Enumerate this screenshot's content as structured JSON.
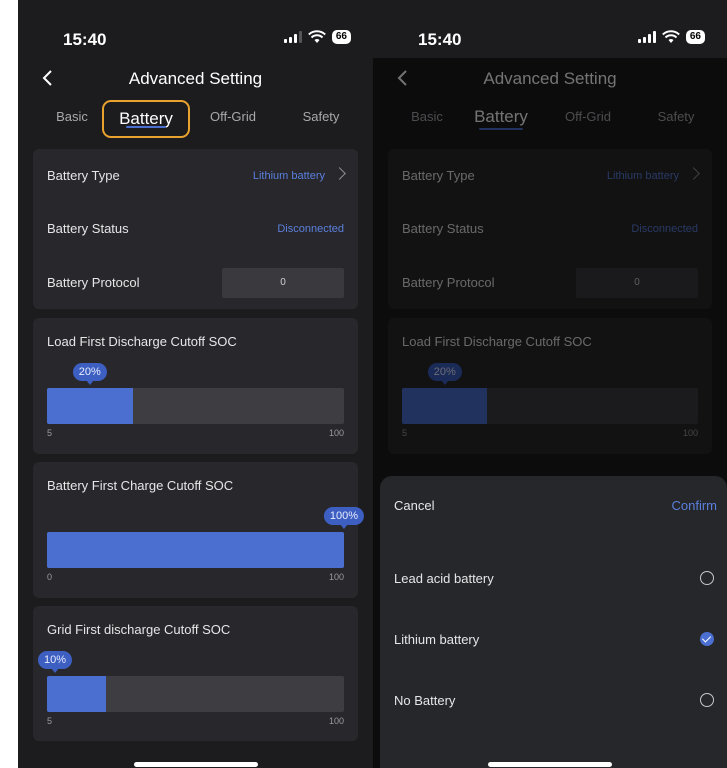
{
  "status": {
    "time": "15:40",
    "battery": "66"
  },
  "header": {
    "title": "Advanced Setting"
  },
  "tabs": [
    {
      "label": "Basic"
    },
    {
      "label": "Battery"
    },
    {
      "label": "Off-Grid"
    },
    {
      "label": "Safety"
    }
  ],
  "battery_info": {
    "type_label": "Battery Type",
    "type_value": "Lithium battery",
    "status_label": "Battery Status",
    "status_value": "Disconnected",
    "protocol_label": "Battery Protocol",
    "protocol_value": "0"
  },
  "sliders": {
    "load_first": {
      "title": "Load First Discharge Cutoff SOC",
      "value_text": "20%",
      "value": 20,
      "min": 5,
      "max": 100,
      "min_label": "5",
      "max_label": "100"
    },
    "battery_first": {
      "title": "Battery First Charge Cutoff SOC",
      "value_text": "100%",
      "value": 100,
      "min": 0,
      "max": 100,
      "min_label": "0",
      "max_label": "100"
    },
    "grid_first": {
      "title": "Grid First discharge Cutoff SOC",
      "value_text": "10%",
      "value": 10,
      "min": 5,
      "max": 100,
      "min_label": "5",
      "max_label": "100"
    }
  },
  "sheet": {
    "cancel": "Cancel",
    "confirm": "Confirm",
    "options": [
      {
        "label": "Lead acid battery",
        "checked": false
      },
      {
        "label": "Lithium battery",
        "checked": true
      },
      {
        "label": "No Battery",
        "checked": false
      }
    ]
  },
  "colors": {
    "accent": "#4a6fd1",
    "focus_ring": "#e8a22e",
    "background": "#1c1c1e",
    "card": "#28282c"
  }
}
